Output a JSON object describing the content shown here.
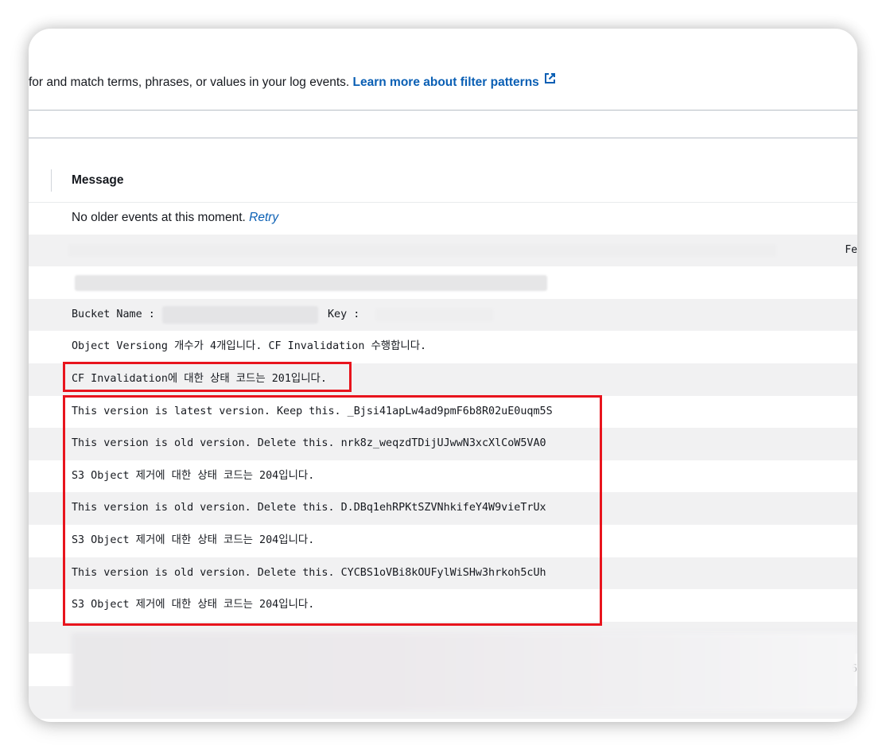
{
  "description": {
    "prefix": "for and match terms, phrases, or values in your log events.",
    "link_label": "Learn more about filter patterns"
  },
  "filter": {
    "value": "",
    "placeholder": ""
  },
  "table": {
    "column_header": "Message",
    "first_row": {
      "text": "No older events at this moment.",
      "retry_label": "Retry"
    },
    "bucket_row": {
      "bucket_label": "Bucket Name :",
      "key_label": "Key :"
    },
    "messages": [
      "Object Versiong 개수가 4개입니다. CF Invalidation 수행합니다.",
      "CF Invalidation에 대한 상태 코드는 201입니다.",
      "This version is latest version. Keep this. _Bjsi41apLw4ad9pmF6b8R02uE0uqm5S",
      "This version is old version. Delete this. nrk8z_weqzdTDijUJwwN3xcXlCoW5VA0",
      "S3 Object 제거에 대한 상태 코드는 204입니다.",
      "This version is old version. Delete this. D.DBq1ehRPKtSZVNhkifeY4W9vieTrUx",
      "S3 Object 제거에 대한 상태 코드는 204입니다.",
      "This version is old version. Delete this. CYCBS1oVBi8kOUFylWiSHw3hrkoh5cUh",
      "S3 Object 제거에 대한 상태 코드는 204입니다."
    ],
    "edge_chars": {
      "row2": "Fe",
      "row12": "6"
    }
  },
  "colors": {
    "link": "#0a5fb4",
    "highlight": "#e8141d",
    "row_alt": "#f1f1f2"
  },
  "icons": {
    "external_link": "external-link-icon"
  }
}
